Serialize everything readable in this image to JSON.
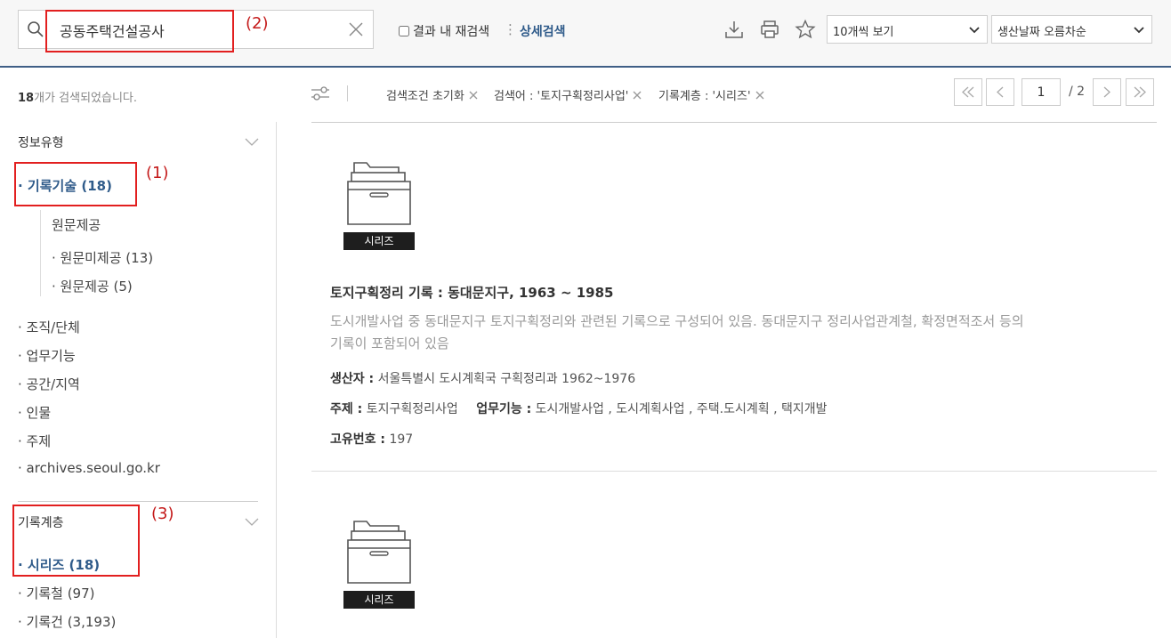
{
  "search": {
    "query": "공동주택건설공사",
    "research_label": "결과 내 재검색",
    "advanced_label": "상세검색"
  },
  "toolbar": {
    "page_size": "10개씩 보기",
    "sort": "생산날짜 오름차순"
  },
  "annotations": [
    "(1)",
    "(2)",
    "(3)"
  ],
  "summary": {
    "count": "18",
    "suffix": "개가 검색되었습니다."
  },
  "facets": {
    "info_type": {
      "title": "정보유형",
      "active": "· 기록기술 (18)",
      "sub_title": "원문제공",
      "sub_items": [
        "· 원문미제공 (13)",
        "· 원문제공 (5)"
      ],
      "items": [
        "· 조직/단체",
        "· 업무기능",
        "· 공간/지역",
        "· 인물",
        "· 주제",
        "· archives.seoul.go.kr"
      ]
    },
    "hierarchy": {
      "title": "기록계층",
      "active": "· 시리즈 (18)",
      "items": [
        "· 기록철 (97)",
        "· 기록건 (3,193)"
      ]
    }
  },
  "filters": {
    "reset": "검색조건 초기화",
    "keyword": "검색어 : '토지구획정리사업'",
    "level": "기록계층 : '시리즈'"
  },
  "pagination": {
    "current": "1",
    "total": "/ 2"
  },
  "results": [
    {
      "badge": "시리즈",
      "title": "토지구획정리 기록 : 동대문지구, 1963 ~ 1985",
      "description": "도시개발사업 중 동대문지구 토지구획정리와 관련된 기록으로 구성되어 있음. 동대문지구 정리사업관계철, 확정면적조서 등의 기록이 포함되어 있음",
      "producer_label": "생산자 :",
      "producer": "서울특별시 도시계획국 구획정리과 1962~1976",
      "subject_label": "주제 :",
      "subject": "토지구획정리사업",
      "function_label": "업무기능 :",
      "function": "도시개발사업 , 도시계획사업 , 주택.도시계획 , 택지개발",
      "id_label": "고유번호 :",
      "id": "197"
    },
    {
      "badge": "시리즈"
    }
  ]
}
